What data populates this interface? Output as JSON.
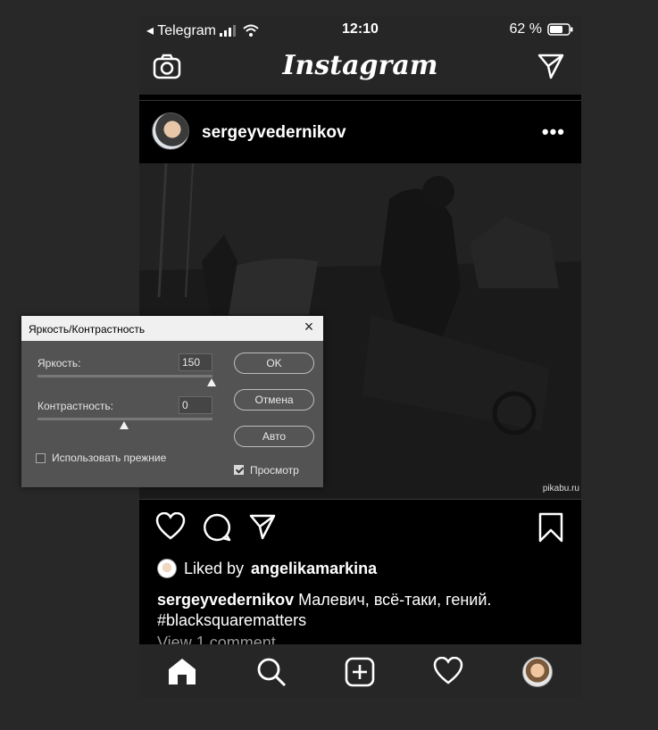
{
  "status_bar": {
    "back_app": "◂ Telegram",
    "time": "12:10",
    "battery": "62 %"
  },
  "app": {
    "logo": "Instagram"
  },
  "post": {
    "username": "sergeyvedernikov",
    "more": "•••",
    "watermark": "pikabu.ru",
    "liked_prefix": "Liked by",
    "liked_user": "angelikamarkina",
    "caption_user": "sergeyvedernikov",
    "caption_text": " Малевич, всё-таки, гений.",
    "hashtag": "#blacksquarematters",
    "view_comments": "View 1 comment"
  },
  "dialog": {
    "title": "Яркость/Контрастность",
    "brightness_label": "Яркость:",
    "brightness_value": "150",
    "contrast_label": "Контрастность:",
    "contrast_value": "0",
    "use_legacy_label": "Использовать прежние",
    "use_legacy_checked": false,
    "preview_label": "Просмотр",
    "preview_checked": true,
    "ok_label": "OK",
    "cancel_label": "Отмена",
    "auto_label": "Авто"
  },
  "icons": {
    "camera": "camera-icon",
    "direct": "paper-plane-icon",
    "like": "heart-icon",
    "comment": "comment-icon",
    "share": "paper-plane-icon",
    "save": "bookmark-icon",
    "home": "home-icon",
    "search": "search-icon",
    "add": "plus-square-icon",
    "activity": "heart-icon",
    "profile": "avatar-icon"
  },
  "colors": {
    "background": "#282828",
    "bars": "#262626",
    "dialog": "#535353"
  }
}
